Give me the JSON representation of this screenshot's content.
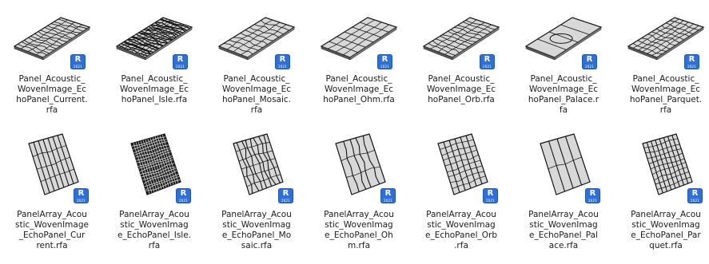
{
  "badge": {
    "letter": "R",
    "sub": "2021"
  },
  "files": [
    {
      "name_lines": [
        "Panel_Acoustic_",
        "WovenImage_Ec",
        "hoPanel_Current.",
        "rfa"
      ],
      "thumb": "flat-panel",
      "pattern": "current"
    },
    {
      "name_lines": [
        "Panel_Acoustic_",
        "WovenImage_Ec",
        "hoPanel_Isle.rfa"
      ],
      "thumb": "flat-panel",
      "pattern": "isle"
    },
    {
      "name_lines": [
        "Panel_Acoustic_",
        "WovenImage_Ec",
        "hoPanel_Mosaic.",
        "rfa"
      ],
      "thumb": "flat-panel",
      "pattern": "mosaic"
    },
    {
      "name_lines": [
        "Panel_Acoustic_",
        "WovenImage_Ec",
        "hoPanel_Ohm.rfa"
      ],
      "thumb": "flat-panel",
      "pattern": "ohm"
    },
    {
      "name_lines": [
        "Panel_Acoustic_",
        "WovenImage_Ec",
        "hoPanel_Orb.rfa"
      ],
      "thumb": "flat-panel",
      "pattern": "orb"
    },
    {
      "name_lines": [
        "Panel_Acoustic_",
        "WovenImage_Ec",
        "hoPanel_Palace.r",
        "fa"
      ],
      "thumb": "flat-panel",
      "pattern": "palace"
    },
    {
      "name_lines": [
        "Panel_Acoustic_",
        "WovenImage_Ec",
        "hoPanel_Parquet.",
        "rfa"
      ],
      "thumb": "flat-panel",
      "pattern": "parquet"
    },
    {
      "name_lines": [
        "PanelArray_Acou",
        "stic_WovenImage",
        "_EchoPanel_Cur",
        "rent.rfa"
      ],
      "thumb": "upright-array",
      "pattern": "current"
    },
    {
      "name_lines": [
        "PanelArray_Acou",
        "stic_WovenImag",
        "e_EchoPanel_Isle.",
        "rfa"
      ],
      "thumb": "upright-array",
      "pattern": "isle"
    },
    {
      "name_lines": [
        "PanelArray_Acou",
        "stic_WovenImag",
        "e_EchoPanel_Mo",
        "saic.rfa"
      ],
      "thumb": "upright-array",
      "pattern": "mosaic"
    },
    {
      "name_lines": [
        "PanelArray_Acou",
        "stic_WovenImag",
        "e_EchoPanel_Oh",
        "m.rfa"
      ],
      "thumb": "upright-array",
      "pattern": "ohm"
    },
    {
      "name_lines": [
        "PanelArray_Acou",
        "stic_WovenImag",
        "e_EchoPanel_Orb",
        ".rfa"
      ],
      "thumb": "upright-array",
      "pattern": "orb"
    },
    {
      "name_lines": [
        "PanelArray_Acou",
        "stic_WovenImag",
        "e_EchoPanel_Pal",
        "ace.rfa"
      ],
      "thumb": "upright-array",
      "pattern": "palace"
    },
    {
      "name_lines": [
        "PanelArray_Acou",
        "stic_WovenImag",
        "e_EchoPanel_Par",
        "quet.rfa"
      ],
      "thumb": "upright-array",
      "pattern": "parquet"
    }
  ],
  "colors": {
    "badge": "#2f6fd6",
    "ink": "#1b1b1b",
    "panel": "#d8d8d8",
    "line": "#111111"
  }
}
